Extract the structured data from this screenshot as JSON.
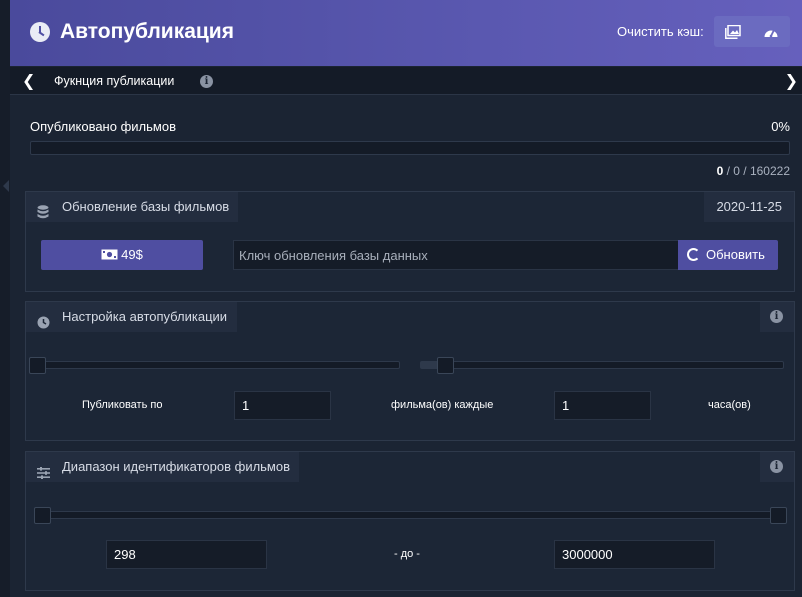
{
  "header": {
    "title": "Автопубликация",
    "clear_cache_label": "Очистить кэш:",
    "clear_cache_buttons": [
      "images-icon",
      "gauge-icon"
    ],
    "accent_color": "#5a58b0"
  },
  "subbar": {
    "title": "Фукнция публикации",
    "left_icon": "chevron-left-icon",
    "right_icon": "chevron-right-icon"
  },
  "publish_progress": {
    "label": "Опубликовано фильмов",
    "percent_text": "0%",
    "percent_value": 0,
    "count_current": "0",
    "count_rest": " / 0 / 160222"
  },
  "db_update": {
    "title": "Обновление базы фильмов",
    "date": "2020-11-25",
    "buy_label": "49$",
    "key_placeholder": "Ключ обновления базы данных",
    "key_value": "",
    "update_label": "Обновить"
  },
  "autopublish": {
    "title": "Настройка автопубликации",
    "publish_by_label": "Публиковать по",
    "films_value": "1",
    "films_every_label": "фильма(ов) каждые",
    "hours_value": "1",
    "hours_label": "часа(ов)",
    "films_slider_fraction": 0,
    "hours_slider_fraction": 0.05
  },
  "id_range": {
    "title": "Диапазон идентификаторов фильмов",
    "from_value": "298",
    "to_label": "- до -",
    "to_value": "3000000"
  }
}
